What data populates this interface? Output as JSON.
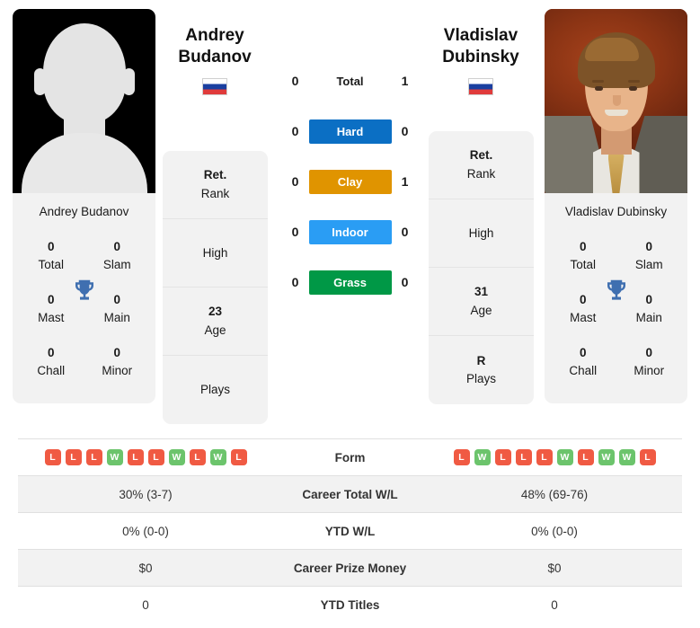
{
  "players": {
    "left": {
      "first_name": "Andrey",
      "last_name": "Budanov",
      "full_name": "Andrey Budanov",
      "flag": "russia-flag",
      "photo": "placeholder-silhouette",
      "titles": [
        {
          "value": "0",
          "label": "Total"
        },
        {
          "value": "0",
          "label": "Slam"
        },
        {
          "value": "0",
          "label": "Mast"
        },
        {
          "value": "0",
          "label": "Main"
        },
        {
          "value": "0",
          "label": "Chall"
        },
        {
          "value": "0",
          "label": "Minor"
        }
      ],
      "attributes": [
        {
          "value": "Ret.",
          "label": "Rank"
        },
        {
          "value": "",
          "label": "High"
        },
        {
          "value": "23",
          "label": "Age"
        },
        {
          "value": "",
          "label": "Plays"
        }
      ],
      "form": [
        "L",
        "L",
        "L",
        "W",
        "L",
        "L",
        "W",
        "L",
        "W",
        "L"
      ],
      "career_total_wl": "30% (3-7)",
      "ytd_wl": "0% (0-0)",
      "career_prize_money": "$0",
      "ytd_titles": "0"
    },
    "right": {
      "first_name": "Vladislav",
      "last_name": "Dubinsky",
      "full_name": "Vladislav Dubinsky",
      "flag": "russia-flag",
      "photo": "portrait-photo",
      "titles": [
        {
          "value": "0",
          "label": "Total"
        },
        {
          "value": "0",
          "label": "Slam"
        },
        {
          "value": "0",
          "label": "Mast"
        },
        {
          "value": "0",
          "label": "Main"
        },
        {
          "value": "0",
          "label": "Chall"
        },
        {
          "value": "0",
          "label": "Minor"
        }
      ],
      "attributes": [
        {
          "value": "Ret.",
          "label": "Rank"
        },
        {
          "value": "",
          "label": "High"
        },
        {
          "value": "31",
          "label": "Age"
        },
        {
          "value": "R",
          "label": "Plays"
        }
      ],
      "form": [
        "L",
        "W",
        "L",
        "L",
        "L",
        "W",
        "L",
        "W",
        "W",
        "L"
      ],
      "career_total_wl": "48% (69-76)",
      "ytd_wl": "0% (0-0)",
      "career_prize_money": "$0",
      "ytd_titles": "0"
    }
  },
  "head_to_head": [
    {
      "label": "Total",
      "left": "0",
      "right": "1",
      "style": "plain",
      "color": ""
    },
    {
      "label": "Hard",
      "left": "0",
      "right": "0",
      "style": "bar",
      "color": "#0b6fc4"
    },
    {
      "label": "Clay",
      "left": "0",
      "right": "1",
      "style": "bar",
      "color": "#e09400"
    },
    {
      "label": "Indoor",
      "left": "0",
      "right": "0",
      "style": "bar",
      "color": "#2a9df4"
    },
    {
      "label": "Grass",
      "left": "0",
      "right": "0",
      "style": "bar",
      "color": "#009846"
    }
  ],
  "stats_rows": [
    {
      "label": "Form",
      "left": "",
      "right": "",
      "type": "form"
    },
    {
      "label": "Career Total W/L",
      "left": "30% (3-7)",
      "right": "48% (69-76)",
      "type": "text"
    },
    {
      "label": "YTD W/L",
      "left": "0% (0-0)",
      "right": "0% (0-0)",
      "type": "text"
    },
    {
      "label": "Career Prize Money",
      "left": "$0",
      "right": "$0",
      "type": "text"
    },
    {
      "label": "YTD Titles",
      "left": "0",
      "right": "0",
      "type": "text"
    }
  ],
  "colors": {
    "hard": "#0b6fc4",
    "clay": "#e09400",
    "indoor": "#2a9df4",
    "grass": "#009846",
    "win_badge": "#6cc46c",
    "loss_badge": "#f05a43",
    "trophy": "#3f6fb0",
    "card_bg": "#f2f2f2"
  },
  "icons": {
    "trophy": "trophy-icon",
    "flag": "flag-icon"
  }
}
